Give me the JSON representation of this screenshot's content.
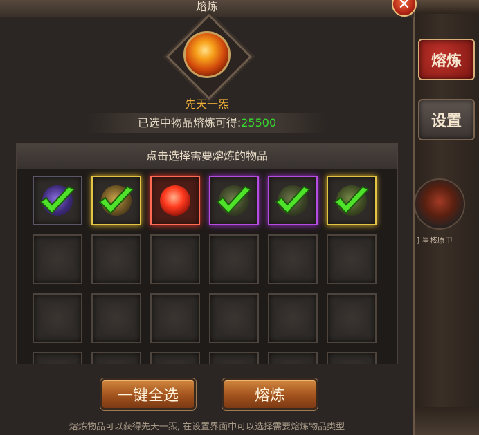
{
  "dialog": {
    "title": "熔炼",
    "close_icon": "✕"
  },
  "reward": {
    "name": "先天一炁",
    "yield_label": "已选中物品熔炼可得:",
    "yield_value": "25500"
  },
  "grid": {
    "header": "点击选择需要熔炼的物品",
    "items": [
      {
        "quality": "blue",
        "selected": true
      },
      {
        "quality": "gold",
        "selected": true
      },
      {
        "quality": "red",
        "selected": false
      },
      {
        "quality": "purple",
        "selected": true
      },
      {
        "quality": "purple",
        "selected": true
      },
      {
        "quality": "gold",
        "selected": true
      }
    ]
  },
  "buttons": {
    "select_all": "一键全选",
    "smelt": "熔炼"
  },
  "footer": "熔炼物品可以获得先天一炁, 在设置界面中可以选择需要熔炼物品类型",
  "side_tabs": {
    "smelt": "熔炼",
    "settings": "设置",
    "item_label": "] 星核原甲"
  },
  "colors": {
    "accent_green": "#36d82f",
    "gold_text": "#f3b23a"
  }
}
